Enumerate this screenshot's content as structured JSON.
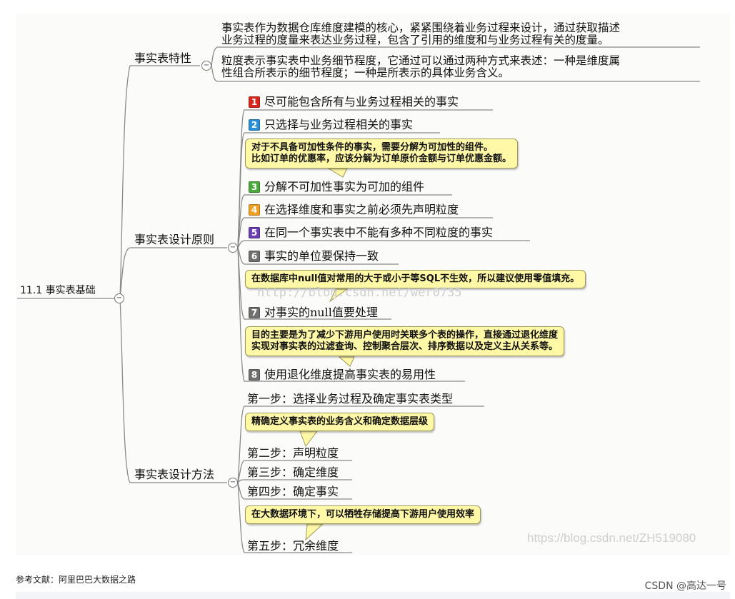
{
  "root": {
    "label": "11.1 事实表基础"
  },
  "branches": {
    "features": {
      "label": "事实表特性",
      "desc1": "事实表作为数据仓库维度建模的核心，紧紧围绕着业务过程来设计，通过获取描述\n业务过程的度量来表达业务过程，包含了引用的维度和与业务过程有关的度量。",
      "desc2": "粒度表示事实表中业务细节程度，它通过可以通过两种方式来表述：一种是维度属\n性组合所表示的细节程度；一种是所表示的具体业务含义。"
    },
    "principles": {
      "label": "事实表设计原则",
      "items": [
        {
          "num": "1",
          "color": "#d9261c",
          "label": "尽可能包含所有与业务过程相关的事实"
        },
        {
          "num": "2",
          "color": "#2a8fd6",
          "label": "只选择与业务过程相关的事实"
        },
        {
          "num": "3",
          "color": "#49a83a",
          "label": "分解不可加性事实为可加的组件"
        },
        {
          "num": "4",
          "color": "#f0a020",
          "label": "在选择维度和事实之前必须先声明粒度"
        },
        {
          "num": "5",
          "color": "#6a3fb3",
          "label": "在同一个事实表中不能有多种不同粒度的事实"
        },
        {
          "num": "6",
          "color": "#707070",
          "label": "事实的单位要保持一致"
        },
        {
          "num": "7",
          "color": "#707070",
          "label": "对事实的null值要处理"
        },
        {
          "num": "8",
          "color": "#707070",
          "label": "使用退化维度提高事实表的易用性"
        }
      ],
      "notes": {
        "note2": "对于不具备可加性条件的事实，需要分解为可加性的组件。\n比如订单的优惠率，应该分解为订单原价金额与订单优惠金额。",
        "note7": "在数据库中null值对常用的大于或小于等SQL不生效，所以建议使用零值填充。",
        "note8": "目的主要是为了减少下游用户使用时关联多个表的操作，直接通过退化维度\n实现对事实表的过滤查询、控制聚合层次、排序数据以及定义主从关系等。"
      }
    },
    "methods": {
      "label": "事实表设计方法",
      "steps": [
        "第一步：选择业务过程及确定事实表类型",
        "第二步：声明粒度",
        "第三步：确定维度",
        "第四步：确定事实",
        "第五步：冗余维度"
      ],
      "notes": {
        "note2": "精确定义事实表的业务含义和确定数据层级",
        "note5": "在大数据环境下，可以牺牲存储提高下游用户使用效率"
      }
    }
  },
  "watermarks": {
    "center": "http://blog.csdn.net/wer0735",
    "right": "https://blog.csdn.net/ZH519080"
  },
  "caption": "参考文献：阿里巴巴大数据之路",
  "footer_brand": "CSDN @高达一号",
  "collapse_symbol": "−"
}
